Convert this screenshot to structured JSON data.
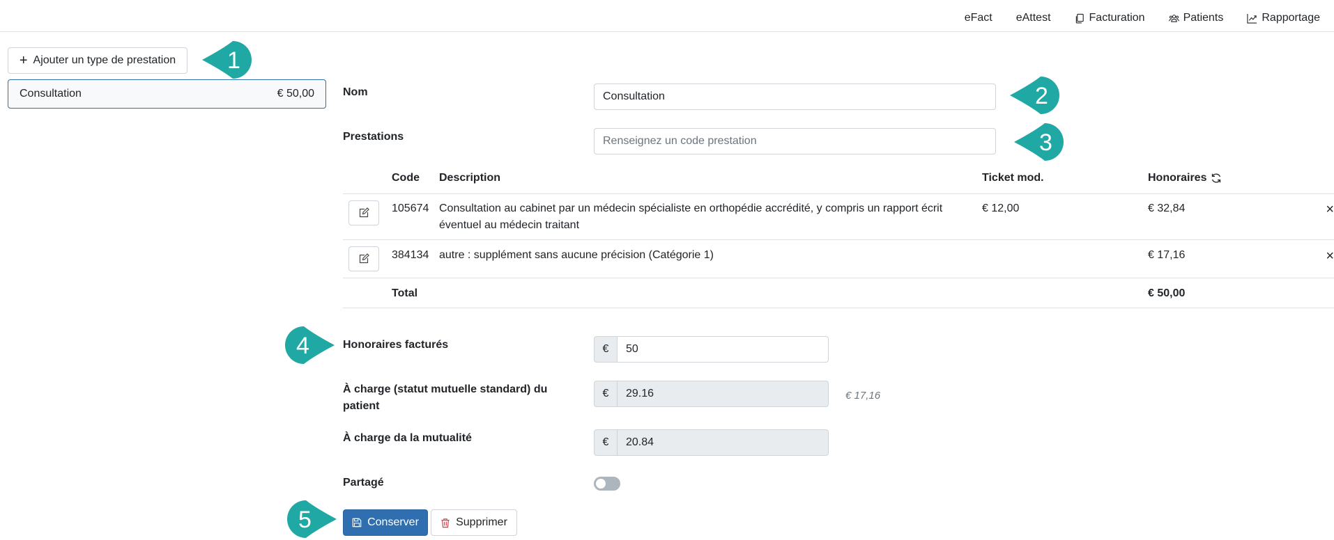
{
  "nav": {
    "items": [
      {
        "label": "eFact",
        "icon": ""
      },
      {
        "label": "eAttest",
        "icon": ""
      },
      {
        "label": "Facturation",
        "icon": "copy-icon"
      },
      {
        "label": "Patients",
        "icon": "people-icon"
      },
      {
        "label": "Rapportage",
        "icon": "chart-line-icon"
      }
    ]
  },
  "sidebar": {
    "add_button_label": "Ajouter un type de prestation",
    "types": [
      {
        "name": "Consultation",
        "price": "€ 50,00"
      }
    ]
  },
  "form": {
    "nom_label": "Nom",
    "nom_value": "Consultation",
    "prestations_label": "Prestations",
    "prestations_placeholder": "Renseignez un code prestation",
    "table": {
      "headers": {
        "code": "Code",
        "description": "Description",
        "ticket": "Ticket mod.",
        "honoraires": "Honoraires"
      },
      "rows": [
        {
          "code": "105674",
          "description": "Consultation au cabinet par un médecin spécialiste en orthopédie accrédité, y compris un rapport écrit éventuel au médecin traitant",
          "ticket": "€ 12,00",
          "honoraires": "€ 32,84"
        },
        {
          "code": "384134",
          "description": "autre : supplément sans aucune précision (Catégorie 1)",
          "ticket": "",
          "honoraires": "€ 17,16"
        }
      ],
      "total_label": "Total",
      "total_value": "€ 50,00"
    },
    "honoraires_label": "Honoraires facturés",
    "currency": "€",
    "honoraires_value": "50",
    "patient_label": "À charge (statut mutuelle standard) du patient",
    "patient_value": "29.16",
    "patient_hint": "€ 17,16",
    "mutualite_label": "À charge da la mutualité",
    "mutualite_value": "20.84",
    "partage_label": "Partagé",
    "partage_on": false,
    "save_label": "Conserver",
    "delete_label": "Supprimer"
  },
  "callouts": [
    "1",
    "2",
    "3",
    "4",
    "5"
  ],
  "colors": {
    "accent": "#2f6fb0",
    "callout": "#1fa8a4",
    "danger": "#dc3545"
  }
}
